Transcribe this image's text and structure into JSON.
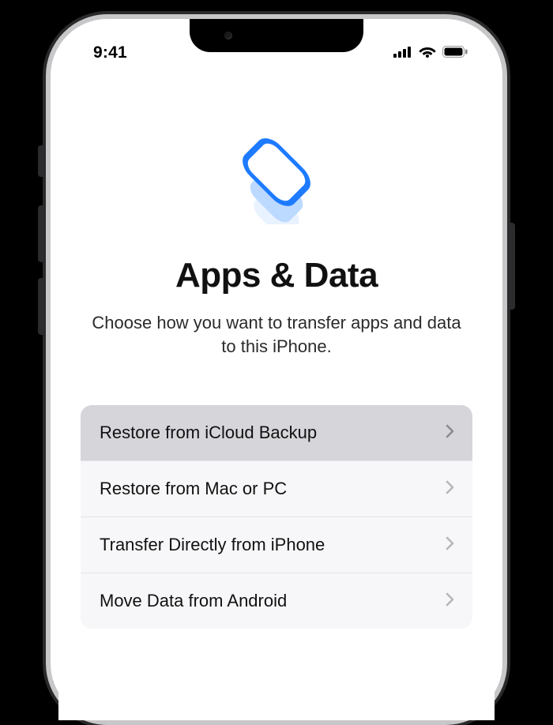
{
  "status": {
    "time": "9:41"
  },
  "page": {
    "title": "Apps & Data",
    "subtitle": "Choose how you want to transfer apps and data to this iPhone."
  },
  "options": [
    {
      "label": "Restore from iCloud Backup",
      "selected": true
    },
    {
      "label": "Restore from Mac or PC",
      "selected": false
    },
    {
      "label": "Transfer Directly from iPhone",
      "selected": false
    },
    {
      "label": "Move Data from Android",
      "selected": false
    }
  ],
  "icons": {
    "hero": "apps-data-stack-icon",
    "cellular": "cellular-icon",
    "wifi": "wifi-icon",
    "battery": "battery-icon",
    "chevron": "chevron-right-icon"
  }
}
